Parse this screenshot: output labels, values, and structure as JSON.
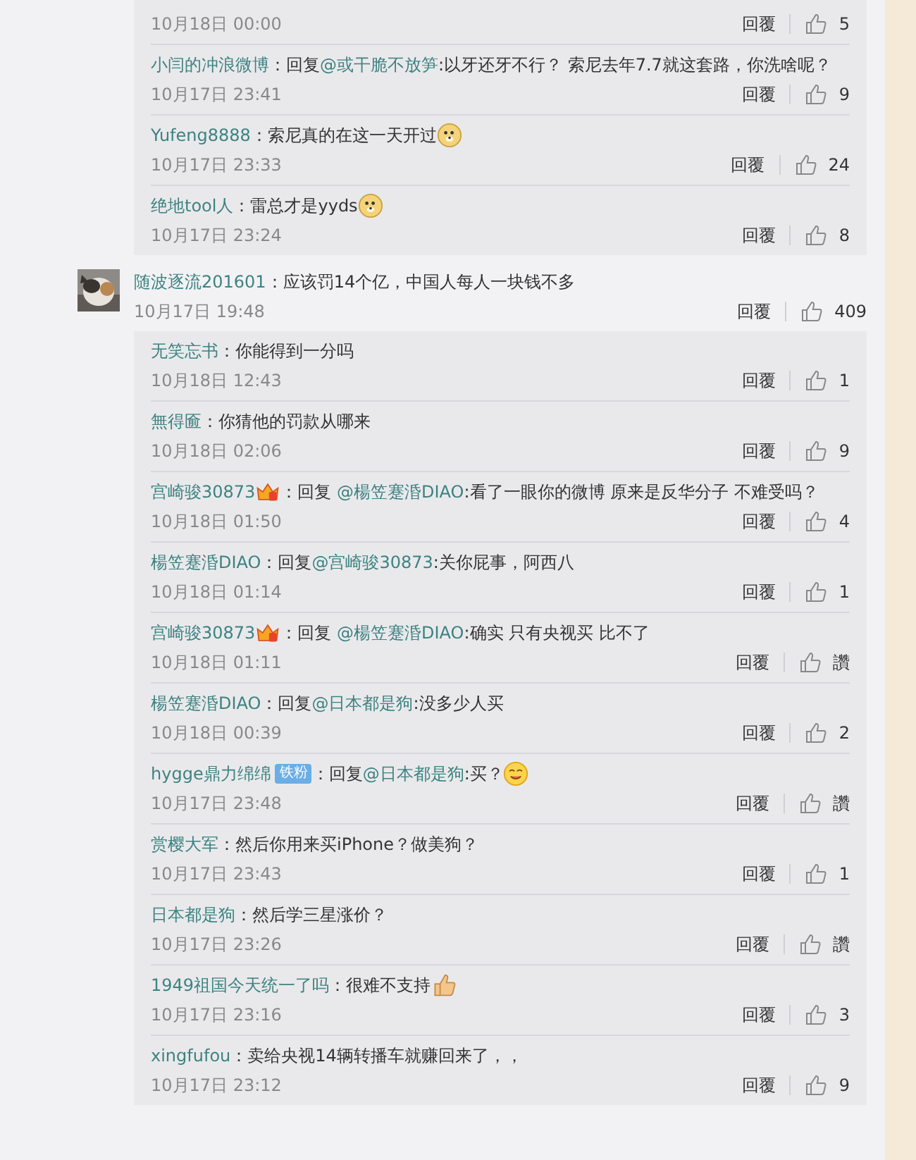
{
  "earlier_thread": {
    "replies": [
      {
        "time": "10月18日 00:00",
        "reply_label": "回覆",
        "likes": "5"
      },
      {
        "author": "小闫的冲浪微博",
        "parts": [
          {
            "kind": "text",
            "text": "：回复"
          },
          {
            "kind": "mention",
            "text": "@或干脆不放笋"
          },
          {
            "kind": "text",
            "text": ":以牙还牙不行？ 索尼去年7.7就这套路，你洗啥呢？"
          }
        ],
        "time": "10月17日 23:41",
        "reply_label": "回覆",
        "likes": "9"
      },
      {
        "author": "Yufeng8888",
        "parts": [
          {
            "kind": "text",
            "text": "：索尼真的在这一天开过"
          },
          {
            "kind": "doge"
          }
        ],
        "time": "10月17日 23:33",
        "reply_label": "回覆",
        "likes": "24"
      },
      {
        "author": "绝地tool人",
        "parts": [
          {
            "kind": "text",
            "text": "：雷总才是yyds"
          },
          {
            "kind": "doge"
          }
        ],
        "time": "10月17日 23:24",
        "reply_label": "回覆",
        "likes": "8"
      }
    ]
  },
  "comment": {
    "author": "随波逐流201601",
    "parts": [
      {
        "kind": "text",
        "text": "：应该罚14个亿，中国人每人一块钱不多"
      }
    ],
    "time": "10月17日 19:48",
    "reply_label": "回覆",
    "likes": "409",
    "replies": [
      {
        "author": "无笑忘书",
        "parts": [
          {
            "kind": "text",
            "text": "：你能得到一分吗"
          }
        ],
        "time": "10月18日 12:43",
        "reply_label": "回覆",
        "likes": "1"
      },
      {
        "author": "無得匬",
        "parts": [
          {
            "kind": "text",
            "text": "：你猜他的罚款从哪来"
          }
        ],
        "time": "10月18日 02:06",
        "reply_label": "回覆",
        "likes": "9"
      },
      {
        "author": "宫崎骏30873",
        "vip_icon": true,
        "parts": [
          {
            "kind": "text",
            "text": "：回复 "
          },
          {
            "kind": "mention",
            "text": "@楊笠蹇涽DIAO"
          },
          {
            "kind": "text",
            "text": ":看了一眼你的微博 原来是反华分子 不难受吗？"
          }
        ],
        "time": "10月18日 01:50",
        "reply_label": "回覆",
        "likes": "4"
      },
      {
        "author": "楊笠蹇涽DIAO",
        "parts": [
          {
            "kind": "text",
            "text": "：回复"
          },
          {
            "kind": "mention",
            "text": "@宫崎骏30873"
          },
          {
            "kind": "text",
            "text": ":关你屁事，阿西八"
          }
        ],
        "time": "10月18日 01:14",
        "reply_label": "回覆",
        "likes": "1"
      },
      {
        "author": "宫崎骏30873",
        "vip_icon": true,
        "parts": [
          {
            "kind": "text",
            "text": "：回复 "
          },
          {
            "kind": "mention",
            "text": "@楊笠蹇涽DIAO"
          },
          {
            "kind": "text",
            "text": ":确实 只有央视买 比不了"
          }
        ],
        "time": "10月18日 01:11",
        "reply_label": "回覆",
        "likes": "讚"
      },
      {
        "author": "楊笠蹇涽DIAO",
        "parts": [
          {
            "kind": "text",
            "text": "：回复"
          },
          {
            "kind": "mention",
            "text": "@日本都是狗"
          },
          {
            "kind": "text",
            "text": ":没多少人买"
          }
        ],
        "time": "10月18日 00:39",
        "reply_label": "回覆",
        "likes": "2"
      },
      {
        "author": "hygge鼎力绵绵",
        "author_badge": "铁粉",
        "parts": [
          {
            "kind": "text",
            "text": "：回复"
          },
          {
            "kind": "mention",
            "text": "@日本都是狗"
          },
          {
            "kind": "text",
            "text": ":买？"
          },
          {
            "kind": "yum"
          }
        ],
        "time": "10月17日 23:48",
        "reply_label": "回覆",
        "likes": "讚"
      },
      {
        "author": "赏樱大军",
        "parts": [
          {
            "kind": "text",
            "text": "：然后你用来买iPhone？做美狗？"
          }
        ],
        "time": "10月17日 23:43",
        "reply_label": "回覆",
        "likes": "1"
      },
      {
        "author": "日本都是狗",
        "parts": [
          {
            "kind": "text",
            "text": "：然后学三星涨价？"
          }
        ],
        "time": "10月17日 23:26",
        "reply_label": "回覆",
        "likes": "讚"
      },
      {
        "author": "1949祖国今天统一了吗",
        "parts": [
          {
            "kind": "text",
            "text": "：很难不支持"
          },
          {
            "kind": "thumb"
          }
        ],
        "time": "10月17日 23:16",
        "reply_label": "回覆",
        "likes": "3"
      },
      {
        "author": "xingfufou",
        "parts": [
          {
            "kind": "text",
            "text": "：卖给央视14辆转播车就赚回来了，，"
          }
        ],
        "time": "10月17日 23:12",
        "reply_label": "回覆",
        "likes": "9"
      }
    ]
  }
}
